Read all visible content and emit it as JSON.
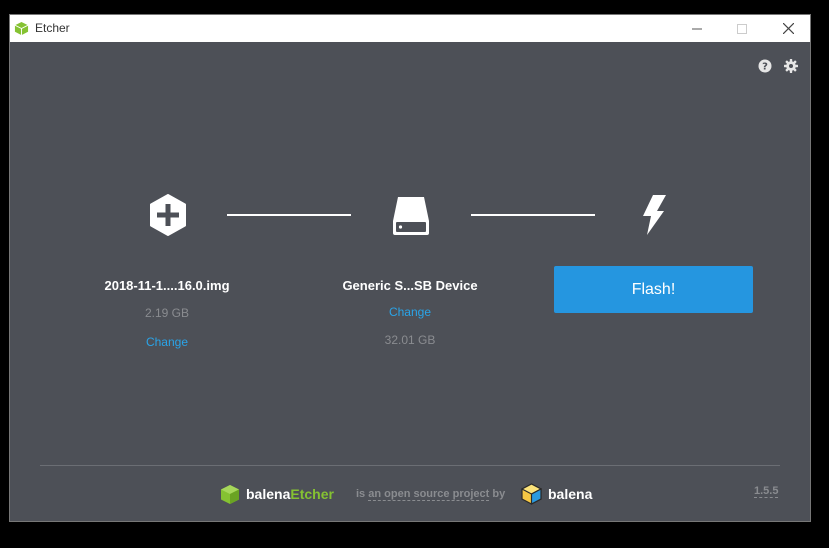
{
  "window": {
    "title": "Etcher",
    "controls": {
      "minimize": "—",
      "maximize": "☐",
      "close": "✕"
    }
  },
  "toolbar": {
    "help_icon": "help-icon",
    "settings_icon": "gear-icon"
  },
  "steps": {
    "image": {
      "filename": "2018-11-1....16.0.img",
      "size": "2.19 GB",
      "change": "Change"
    },
    "drive": {
      "name": "Generic S...SB Device",
      "change": "Change",
      "size": "32.01 GB"
    },
    "flash": {
      "label": "Flash!"
    }
  },
  "footer": {
    "brand_prefix": "balena",
    "brand_accent": "Etcher",
    "text_pre": "is",
    "text_link": "an open source project",
    "text_post": "by",
    "company": "balena",
    "version": "1.5.5"
  },
  "colors": {
    "background": "#4d5057",
    "accent": "#2596e0",
    "link": "#2aa4e8",
    "etcher_green": "#85c232"
  }
}
